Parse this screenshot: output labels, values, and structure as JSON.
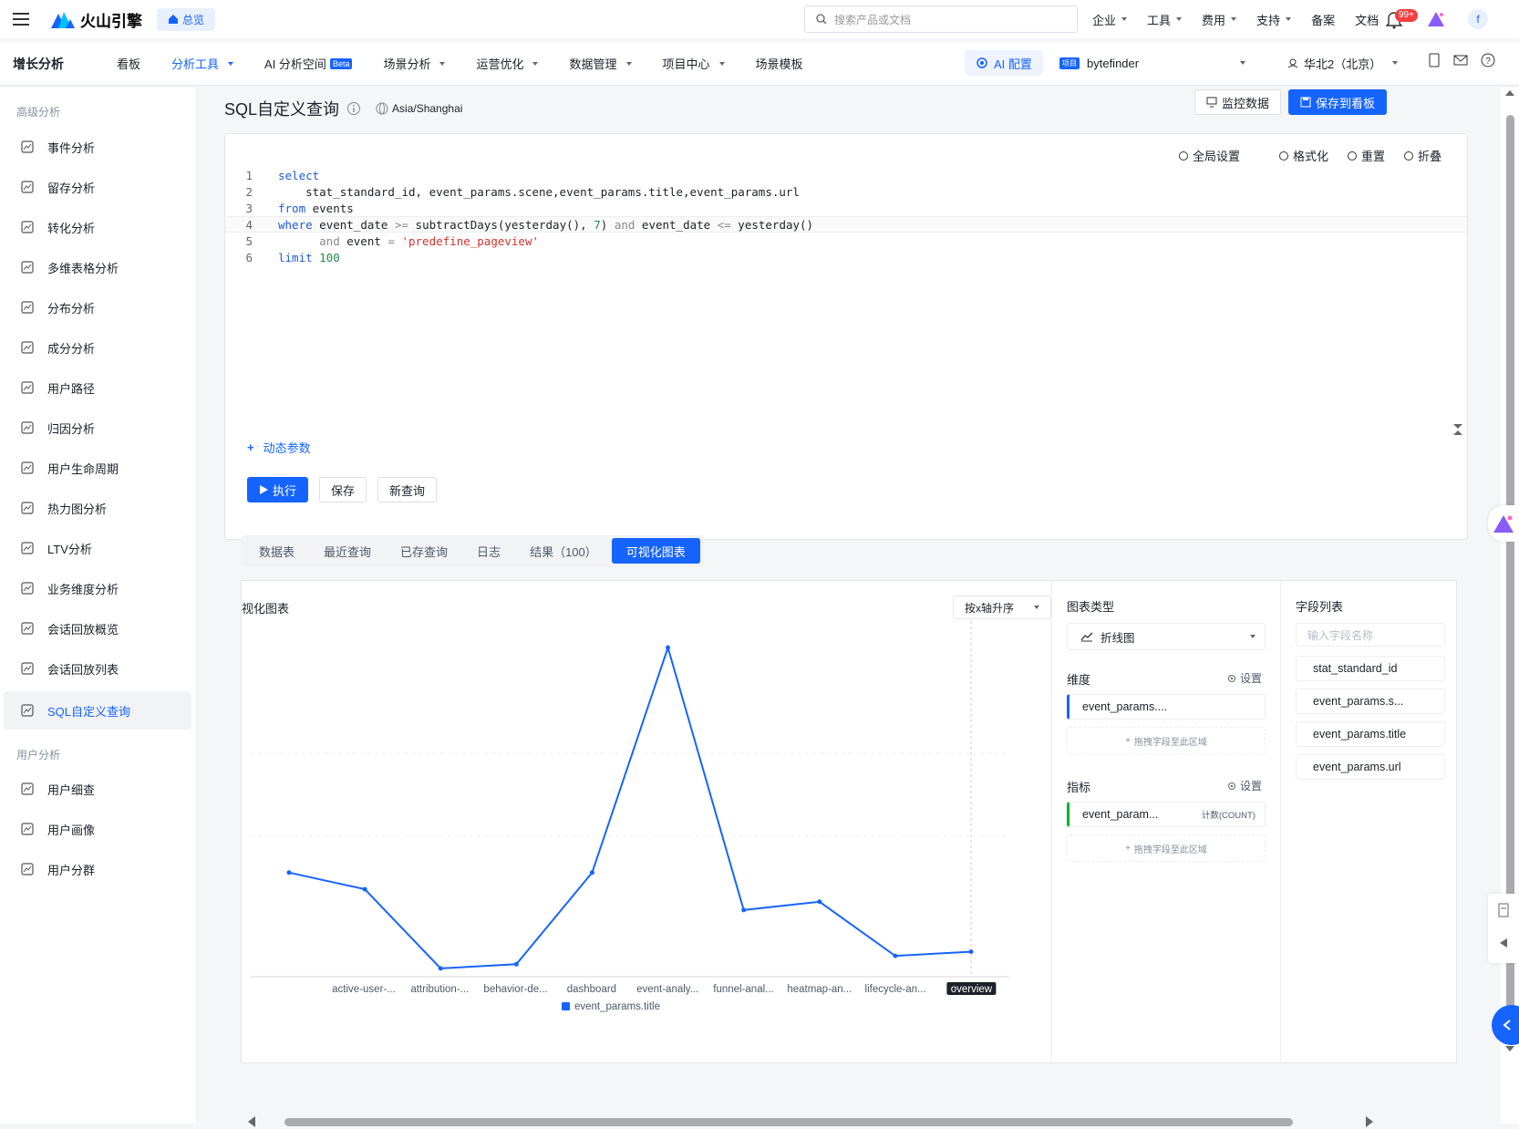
{
  "topbar": {
    "brand": "火山引擎",
    "home_label": "总览",
    "search_placeholder": "搜索产品或文档",
    "nav": [
      "企业",
      "工具",
      "费用",
      "支持",
      "备案",
      "文档"
    ],
    "nav_has_caret": [
      true,
      true,
      true,
      true,
      false,
      false
    ],
    "badge": "99+",
    "avatar_letter": "f"
  },
  "secnav": {
    "brand": "增长分析",
    "items": [
      {
        "label": "看板",
        "active": false,
        "caret": false
      },
      {
        "label": "分析工具",
        "active": true,
        "caret": true
      },
      {
        "label": "AI 分析空间",
        "active": false,
        "caret": false,
        "beta": "Beta"
      },
      {
        "label": "场景分析",
        "active": false,
        "caret": true
      },
      {
        "label": "运营优化",
        "active": false,
        "caret": true
      },
      {
        "label": "数据管理",
        "active": false,
        "caret": true
      },
      {
        "label": "项目中心",
        "active": false,
        "caret": true
      },
      {
        "label": "场景模板",
        "active": false,
        "caret": false
      }
    ],
    "ai_config": "AI 配置",
    "project_tag": "项目",
    "project_name": "bytefinder",
    "region": "华北2（北京）"
  },
  "sidebar": {
    "group1": "高级分析",
    "items1": [
      {
        "label": "事件分析",
        "icon": "event-icon"
      },
      {
        "label": "留存分析",
        "icon": "retention-icon"
      },
      {
        "label": "转化分析",
        "icon": "funnel-icon"
      },
      {
        "label": "多维表格分析",
        "icon": "table-icon"
      },
      {
        "label": "分布分析",
        "icon": "bar-chart-icon"
      },
      {
        "label": "成分分析",
        "icon": "pie-icon"
      },
      {
        "label": "用户路径",
        "icon": "path-icon"
      },
      {
        "label": "归因分析",
        "icon": "attribution-icon"
      },
      {
        "label": "用户生命周期",
        "icon": "lifecycle-icon"
      },
      {
        "label": "热力图分析",
        "icon": "heatmap-icon"
      },
      {
        "label": "LTV分析",
        "icon": "ltv-icon"
      },
      {
        "label": "业务维度分析",
        "icon": "dimension-icon"
      },
      {
        "label": "会话回放概览",
        "icon": "session-icon"
      },
      {
        "label": "会话回放列表",
        "icon": "session-list-icon"
      },
      {
        "label": "SQL自定义查询",
        "icon": "sql-icon",
        "active": true
      }
    ],
    "group2": "用户分析",
    "items2": [
      {
        "label": "用户细查",
        "icon": "user-search-icon"
      },
      {
        "label": "用户画像",
        "icon": "user-profile-icon"
      },
      {
        "label": "用户分群",
        "icon": "user-group-icon"
      }
    ]
  },
  "page": {
    "title": "SQL自定义查询",
    "timezone": "Asia/Shanghai",
    "monitor_btn": "监控数据",
    "save_dashboard_btn": "保存到看板"
  },
  "editor": {
    "tools": [
      "全局设置",
      "格式化",
      "重置",
      "折叠"
    ],
    "lines": [
      [
        {
          "t": "select",
          "c": "kw"
        }
      ],
      [
        {
          "t": "    stat_standard_id, event_params.scene,event_params.title,event_params.url",
          "c": ""
        }
      ],
      [
        {
          "t": "from",
          "c": "kw"
        },
        {
          "t": " events",
          "c": ""
        }
      ],
      [
        {
          "t": "where",
          "c": "kw"
        },
        {
          "t": " event_date ",
          "c": ""
        },
        {
          "t": ">=",
          "c": "op"
        },
        {
          "t": " subtractDays(yesterday(), ",
          "c": ""
        },
        {
          "t": "7",
          "c": "num"
        },
        {
          "t": ") ",
          "c": ""
        },
        {
          "t": "and",
          "c": "op"
        },
        {
          "t": " event_date ",
          "c": ""
        },
        {
          "t": "<=",
          "c": "op"
        },
        {
          "t": " yesterday()",
          "c": ""
        }
      ],
      [
        {
          "t": "      ",
          "c": ""
        },
        {
          "t": "and",
          "c": "op"
        },
        {
          "t": " event ",
          "c": ""
        },
        {
          "t": "=",
          "c": "op"
        },
        {
          "t": " ",
          "c": ""
        },
        {
          "t": "'predefine_pageview'",
          "c": "str"
        }
      ],
      [
        {
          "t": "limit",
          "c": "kw"
        },
        {
          "t": " ",
          "c": ""
        },
        {
          "t": "100",
          "c": "num"
        }
      ]
    ],
    "dynamic_params": "动态参数",
    "run_btn": "执行",
    "save_btn": "保存",
    "new_query_btn": "新查询"
  },
  "result_tabs": [
    "数据表",
    "最近查询",
    "已存查询",
    "日志",
    "结果（100）",
    "可视化图表"
  ],
  "active_tab": 5,
  "viz": {
    "title": "视化图表",
    "sort_label": "按x轴升序",
    "chart_type_label": "图表类型",
    "chart_type_value": "折线图",
    "dimension_label": "维度",
    "setting_label": "设置",
    "dimension_chip": "event_params....",
    "drop_hint": "拖拽字段至此区域",
    "metric_label": "指标",
    "metric_chip": "event_param...",
    "metric_agg": "计数(COUNT)",
    "field_list_label": "字段列表",
    "field_search_placeholder": "输入字段名称",
    "fields": [
      "stat_standard_id",
      "event_params.s...",
      "event_params.title",
      "event_params.url"
    ]
  },
  "chart_data": {
    "type": "line",
    "categories": [
      "active-user-...",
      "attribution-...",
      "behavior-de...",
      "dashboard",
      "event-analy...",
      "funnel-anal...",
      "heatmap-an...",
      "lifecycle-an...",
      "overview"
    ],
    "series": [
      {
        "name": "event_params.title",
        "values": [
          41,
          37,
          18,
          19,
          41,
          95,
          32,
          34,
          21,
          22
        ]
      }
    ],
    "x_points": 10,
    "highlighted_category": "overview",
    "legend": "bottom-center",
    "color": "#1664ff"
  }
}
